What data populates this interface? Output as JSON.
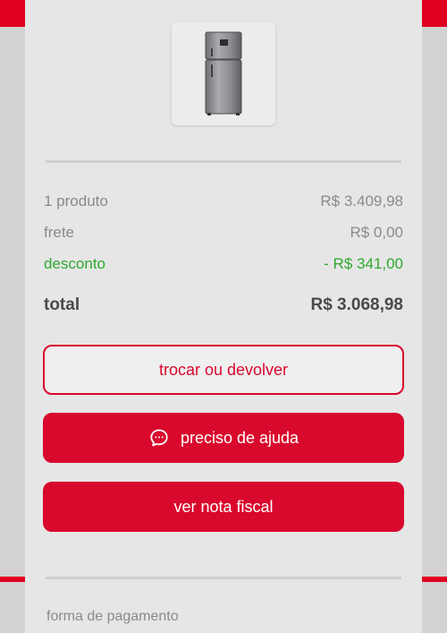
{
  "product": {
    "image_icon": "refrigerator-image"
  },
  "summary": {
    "items_label": "1 produto",
    "items_value": "R$ 3.409,98",
    "shipping_label": "frete",
    "shipping_value": "R$ 0,00",
    "discount_label": "desconto",
    "discount_value": "- R$ 341,00",
    "total_label": "total",
    "total_value": "R$ 3.068,98"
  },
  "actions": {
    "return_label": "trocar ou devolver",
    "help_label": "preciso de ajuda",
    "help_icon": "chat-bubble-icon",
    "invoice_label": "ver nota fiscal"
  },
  "payment": {
    "section_label": "forma de pagamento"
  },
  "colors": {
    "brand": "#d9082d",
    "discount": "#2fa82f",
    "text_muted": "#8a8a8a",
    "text_strong": "#4a4a4a"
  }
}
